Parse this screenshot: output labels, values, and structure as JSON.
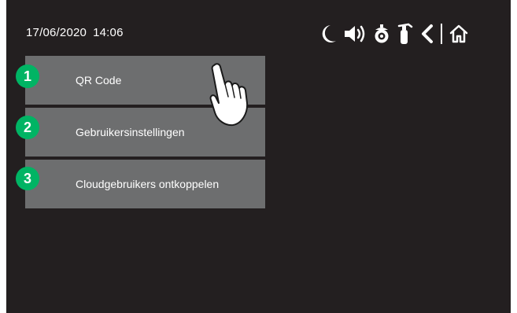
{
  "status_bar": {
    "date": "17/06/2020",
    "time": "14:06",
    "icons": [
      "moon-icon",
      "speaker-icon",
      "camera-icon",
      "fire-extinguisher-icon",
      "back-icon",
      "home-icon"
    ]
  },
  "menu": {
    "items": [
      {
        "number": "1",
        "label": "QR Code"
      },
      {
        "number": "2",
        "label": "Gebruikersinstellingen"
      },
      {
        "number": "3",
        "label": "Cloudgebruikers ontkoppelen"
      }
    ]
  },
  "colors": {
    "background": "#231f20",
    "menu_item": "#6d6e6f",
    "badge": "#00b464",
    "text": "#ffffff"
  }
}
